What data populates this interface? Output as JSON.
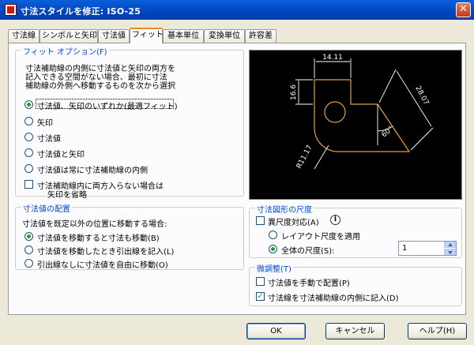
{
  "window": {
    "title": "寸法スタイルを修正: ISO-25",
    "close_glyph": "✕"
  },
  "tabs": [
    {
      "label": "寸法線"
    },
    {
      "label": "シンボルと矢印"
    },
    {
      "label": "寸法値"
    },
    {
      "label": "フィット",
      "active": true
    },
    {
      "label": "基本単位"
    },
    {
      "label": "変換単位"
    },
    {
      "label": "許容差"
    }
  ],
  "fit_options": {
    "title": "フィット オプション(F)",
    "description": [
      "寸法補助線の内側に寸法値と矢印の両方を",
      "記入できる空間がない場合、最初に寸法",
      "補助線の外側へ移動するものを次から選択"
    ],
    "options": [
      {
        "label": "寸法値、矢印のいずれか(最適フィット)",
        "selected": true
      },
      {
        "label": "矢印",
        "selected": false
      },
      {
        "label": "寸法値",
        "selected": false
      },
      {
        "label": "寸法値と矢印",
        "selected": false
      },
      {
        "label": "寸法値は常に寸法補助線の内側",
        "selected": false
      }
    ],
    "suppress_arrows": {
      "label_line1": "寸法補助線内に両方入らない場合は",
      "label_line2": "矢印を省略",
      "checked": false
    }
  },
  "text_placement": {
    "title": "寸法値の配置",
    "description": "寸法値を既定以外の位置に移動する場合:",
    "options": [
      {
        "label": "寸法値を移動すると寸法も移動(B)",
        "selected": true
      },
      {
        "label": "寸法値を移動したとき引出線を記入(L)",
        "selected": false
      },
      {
        "label": "引出線なしに寸法値を自由に移動(O)",
        "selected": false
      }
    ]
  },
  "preview": {
    "dims": [
      "14.11",
      "16.6",
      "28.07",
      "60°",
      "R11.17"
    ],
    "colors": {
      "shape": "#e0a040",
      "dim": "#ffffff",
      "background": "#000000"
    }
  },
  "scale": {
    "title": "寸法図形の尺度",
    "annotative": {
      "label": "異尺度対応(A)",
      "checked": false
    },
    "info_glyph": "i",
    "layout_option": {
      "label": "レイアウト尺度を適用",
      "selected": false
    },
    "overall_option": {
      "label": "全体の尺度(S):",
      "selected": true
    },
    "overall_value": "1"
  },
  "fine_tuning": {
    "title": "微調整(T)",
    "manual_place": {
      "label": "寸法値を手動で配置(P)",
      "checked": false
    },
    "draw_inside": {
      "label": "寸法線を寸法補助線の内側に記入(D)",
      "checked": true
    }
  },
  "buttons": {
    "ok": "OK",
    "cancel": "キャンセル",
    "help": "ヘルプ(H)"
  },
  "check_glyph": "✓"
}
